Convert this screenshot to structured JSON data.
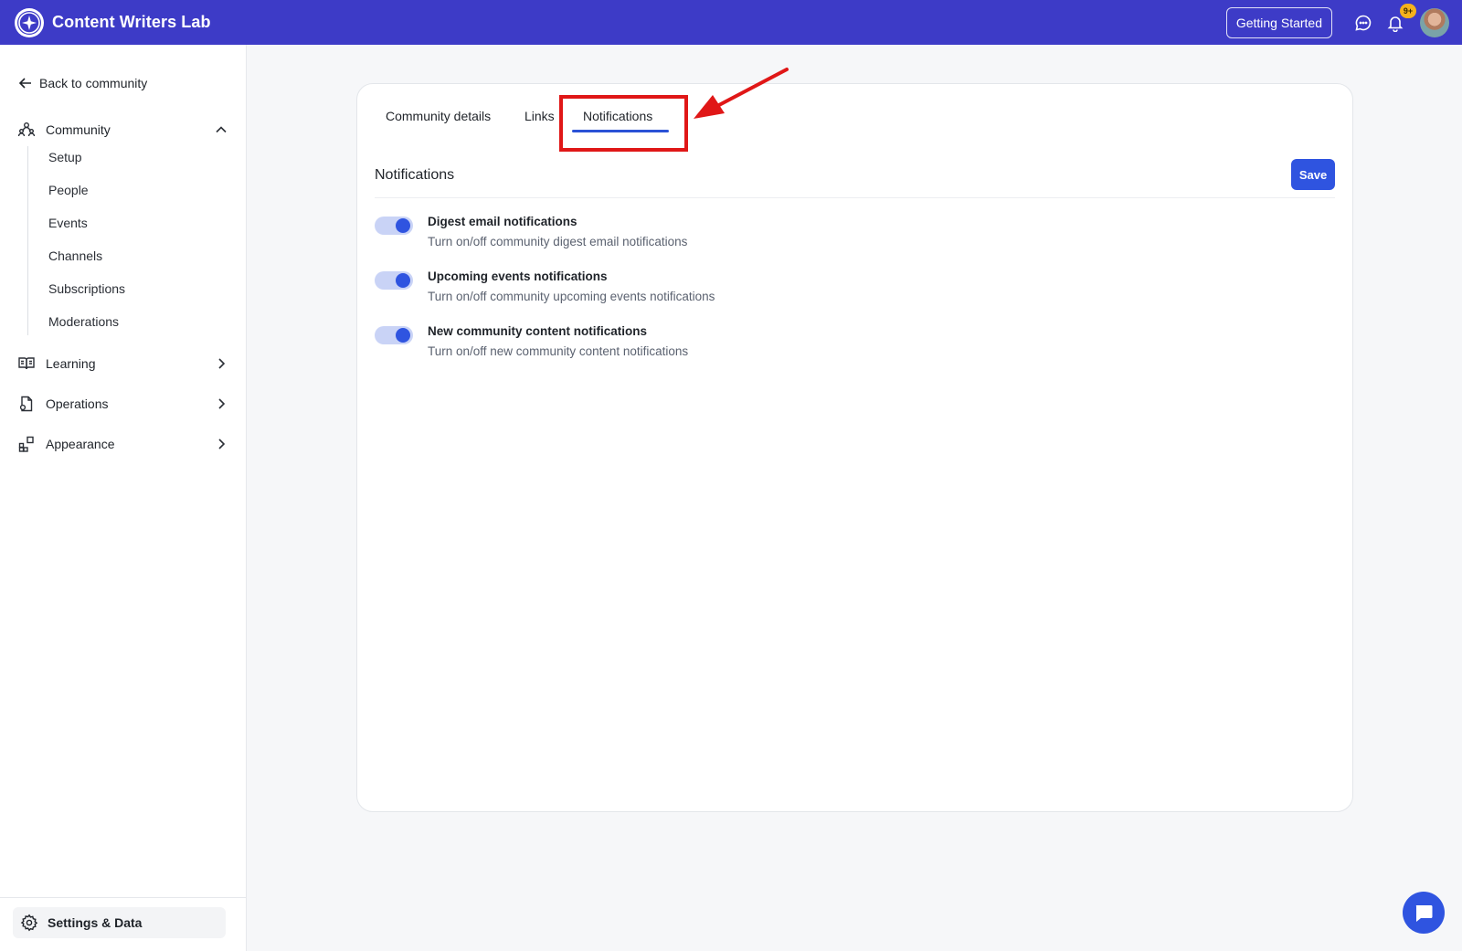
{
  "app": {
    "name": "Content Writers Lab",
    "logo_icon": "sparkle-icon",
    "brand_color": "#3d3bc7",
    "accent_color": "#2f54e0"
  },
  "header": {
    "getting_started_label": "Getting Started",
    "notification_badge": "9+",
    "chat_icon": "chat-bubble-icon",
    "bell_icon": "bell-icon"
  },
  "sidebar": {
    "back_label": "Back to community",
    "sections": [
      {
        "label": "Community",
        "icon": "community-icon",
        "expanded": true
      },
      {
        "label": "Learning",
        "icon": "book-icon",
        "expanded": false
      },
      {
        "label": "Operations",
        "icon": "document-icon",
        "expanded": false
      },
      {
        "label": "Appearance",
        "icon": "grid-icon",
        "expanded": false
      }
    ],
    "community_items": [
      "Setup",
      "People",
      "Events",
      "Channels",
      "Subscriptions",
      "Moderations"
    ],
    "settings_label": "Settings & Data"
  },
  "tabs": [
    {
      "label": "Community details",
      "active": false
    },
    {
      "label": "Links",
      "active": false
    },
    {
      "label": "Notifications",
      "active": true
    }
  ],
  "panel": {
    "title": "Notifications",
    "save_label": "Save",
    "notifications": [
      {
        "title": "Digest email notifications",
        "description": "Turn on/off community digest email notifications",
        "enabled": true
      },
      {
        "title": "Upcoming events notifications",
        "description": "Turn on/off community upcoming events notifications",
        "enabled": true
      },
      {
        "title": "New community content notifications",
        "description": "Turn on/off new community content notifications",
        "enabled": true
      }
    ]
  },
  "annotation": {
    "highlight_color": "#e01717"
  }
}
